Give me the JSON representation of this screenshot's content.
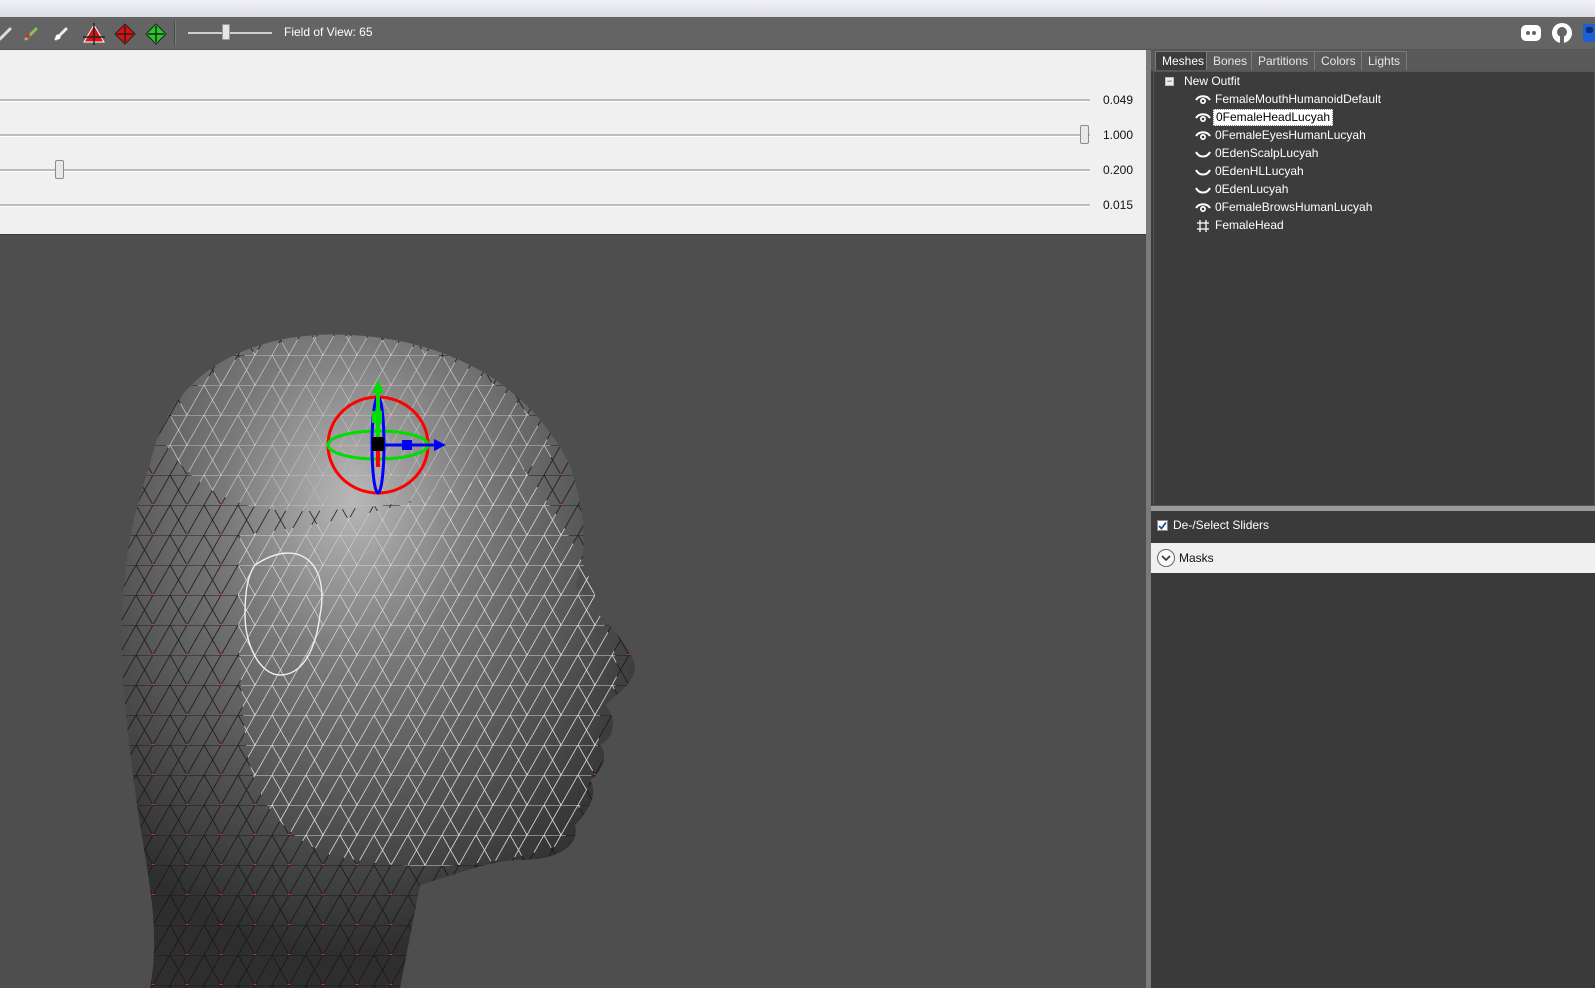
{
  "toolbar": {
    "tools": [
      "brush-tool-white",
      "brush-tool-green",
      "brush-tool-pale",
      "move-vertex-red",
      "scale-diamond-red",
      "move-diamond-green"
    ],
    "fov_label": "Field of View: 65",
    "fov_value": 65,
    "right_icons": [
      "discord-icon",
      "github-icon",
      "paypal-icon"
    ]
  },
  "sliders": [
    {
      "value": "0.049",
      "fraction": 0.0
    },
    {
      "value": "1.000",
      "fraction": 1.0
    },
    {
      "value": "0.200",
      "fraction": 0.06
    },
    {
      "value": "0.015",
      "fraction": 0.0
    }
  ],
  "panel": {
    "tabs": [
      "Meshes",
      "Bones",
      "Partitions",
      "Colors",
      "Lights"
    ],
    "active_tab": "Meshes",
    "tree_root": "New Outfit",
    "meshes": [
      {
        "name": "FemaleMouthHumanoidDefault",
        "icon": "eye-open-icon",
        "selected": false
      },
      {
        "name": "0FemaleHeadLucyah",
        "icon": "eye-open-icon",
        "selected": true
      },
      {
        "name": "0FemaleEyesHumanLucyah",
        "icon": "eye-open-icon",
        "selected": false
      },
      {
        "name": "0EdenScalpLucyah",
        "icon": "eye-closed-icon",
        "selected": false
      },
      {
        "name": "0EdenHLLucyah",
        "icon": "eye-closed-icon",
        "selected": false
      },
      {
        "name": "0EdenLucyah",
        "icon": "eye-closed-icon",
        "selected": false
      },
      {
        "name": "0FemaleBrowsHumanLucyah",
        "icon": "eye-open-icon",
        "selected": false
      },
      {
        "name": "FemaleHead",
        "icon": "grid-icon",
        "selected": false
      }
    ],
    "deselect_label": "De-/Select Sliders",
    "deselect_checked": true,
    "masks_label": "Masks"
  },
  "colors": {
    "toolbar_bg": "#646464",
    "viewport_bg": "#4e4e4e",
    "panel_bg": "#3a3a3a",
    "gizmo_x": "#ff0000",
    "gizmo_y": "#00dd00",
    "gizmo_z": "#0000ff"
  }
}
